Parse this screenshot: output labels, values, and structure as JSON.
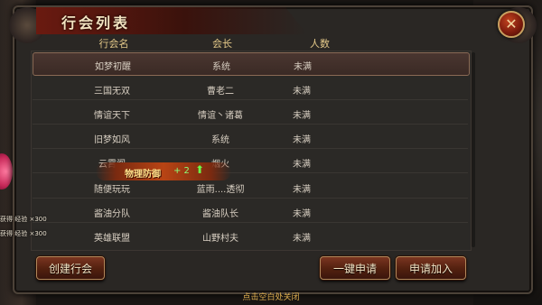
{
  "window": {
    "title": "行会列表",
    "close_label": "✕"
  },
  "table": {
    "headers": [
      "行会名",
      "会长",
      "人数"
    ],
    "rows": [
      {
        "name": "如梦初醒",
        "leader": "系统",
        "count": "未满",
        "selected": true
      },
      {
        "name": "三国无双",
        "leader": "曹老二",
        "count": "未满"
      },
      {
        "name": "情谊天下",
        "leader": "情谊丶诸葛",
        "count": "未满"
      },
      {
        "name": "旧梦如风",
        "leader": "系统",
        "count": "未满"
      },
      {
        "name": "云霄阁",
        "leader": "烟火",
        "count": "未满"
      },
      {
        "name": "随便玩玩",
        "leader": "蓝雨....透彻",
        "count": "未满"
      },
      {
        "name": "酱油分队",
        "leader": "酱油队长",
        "count": "未满"
      },
      {
        "name": "英雄联盟",
        "leader": "山野村夫",
        "count": "未满"
      }
    ]
  },
  "buttons": {
    "create": "创建行会",
    "quick_apply": "一键申请",
    "apply_join": "申请加入"
  },
  "footer_hint": "点击空白处关闭",
  "buff_popup": {
    "label": "物理防御",
    "value": "+ 2",
    "arrow": "⬆"
  },
  "side_notes": [
    "获得 经验 ×300",
    "获得 经验 ×300"
  ],
  "colors": {
    "title_bar": "#6a1a10",
    "button_fill": "#7a3520",
    "header_text": "#e4c989",
    "buff_gold": "#ffe18a",
    "buff_green": "#8cff7a"
  }
}
